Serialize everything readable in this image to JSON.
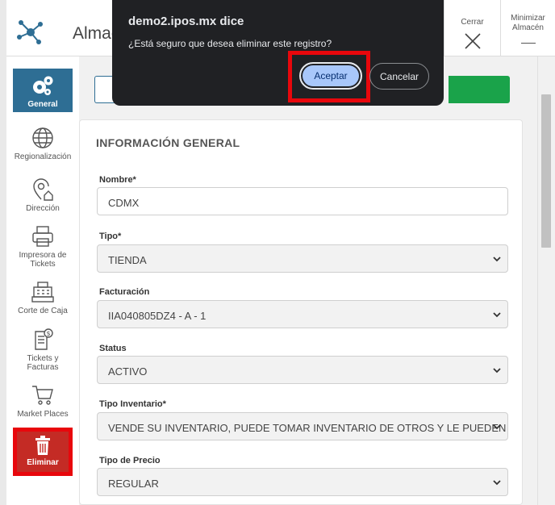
{
  "window": {
    "title": "Almac",
    "close_label": "Cerrar",
    "minimize_label_1": "Minimizar",
    "minimize_label_2": "Almacén"
  },
  "sidebar": {
    "items": [
      {
        "label": "General",
        "icon": "gears-icon"
      },
      {
        "label": "Regionalización",
        "icon": "globe-icon"
      },
      {
        "label": "Dirección",
        "icon": "location-home-icon"
      },
      {
        "label_1": "Impresora de",
        "label_2": "Tickets",
        "icon": "printer-icon"
      },
      {
        "label": "Corte de Caja",
        "icon": "cash-register-icon"
      },
      {
        "label_1": "Tickets y",
        "label_2": "Facturas",
        "icon": "invoice-icon"
      },
      {
        "label": "Market Places",
        "icon": "cart-icon"
      },
      {
        "label": "Eliminar",
        "icon": "trash-icon"
      }
    ]
  },
  "form": {
    "section_title": "INFORMACIÓN GENERAL",
    "nombre": {
      "label": "Nombre*",
      "value": "CDMX"
    },
    "tipo": {
      "label": "Tipo*",
      "value": "TIENDA"
    },
    "facturacion": {
      "label": "Facturación",
      "value": "IIA040805DZ4 - A - 1"
    },
    "status": {
      "label": "Status",
      "value": "ACTIVO"
    },
    "tipo_inventario": {
      "label": "Tipo Inventario*",
      "value": "VENDE SU INVENTARIO, PUEDE TOMAR INVENTARIO DE OTROS Y LE PUEDEN TOMAR"
    },
    "tipo_precio": {
      "label": "Tipo de Precio",
      "value": "REGULAR"
    }
  },
  "dialog": {
    "title": "demo2.ipos.mx dice",
    "message": "¿Está seguro que desea eliminar este registro?",
    "ok_label": "Aceptar",
    "cancel_label": "Cancelar"
  },
  "colors": {
    "primary": "#2e6e94",
    "danger": "#c42b25",
    "highlight": "#e8070c",
    "success": "#1aa34a",
    "dialog_bg": "#202124"
  }
}
